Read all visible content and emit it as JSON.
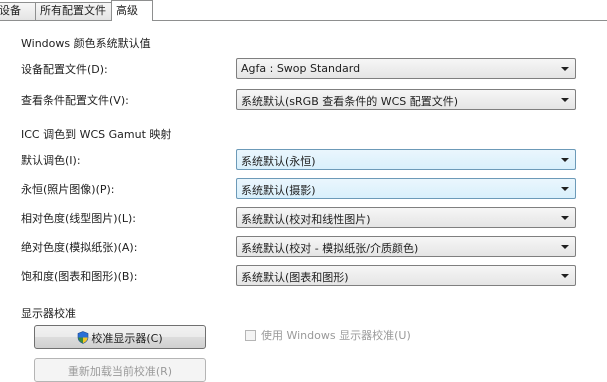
{
  "tabs": [
    "设备",
    "所有配置文件",
    "高级"
  ],
  "windows_defaults": {
    "heading": "Windows 颜色系统默认值",
    "device_profile": {
      "label": "设备配置文件(D):",
      "value": "Agfa : Swop Standard"
    },
    "viewing_conditions": {
      "label": "查看条件配置文件(V):",
      "value": "系统默认(sRGB 查看条件的 WCS 配置文件)"
    }
  },
  "gamut_mapping": {
    "heading": "ICC 调色到 WCS Gamut 映射",
    "rows": [
      {
        "label": "默认调色(I):",
        "value": "系统默认(永恒)"
      },
      {
        "label": "永恒(照片图像)(P):",
        "value": "系统默认(摄影)"
      },
      {
        "label": "相对色度(线型图片)(L):",
        "value": "系统默认(校对和线性图片)"
      },
      {
        "label": "绝对色度(模拟纸张)(A):",
        "value": "系统默认(校对 - 模拟纸张/介质颜色)"
      },
      {
        "label": "饱和度(图表和图形)(B):",
        "value": "系统默认(图表和图形)"
      }
    ]
  },
  "calibration": {
    "heading": "显示器校准",
    "calibrate_button": "校准显示器(C)",
    "use_calibration_label": "使用 Windows 显示器校准(U)",
    "use_calibration_checked": false,
    "reload_button": "重新加载当前校准(R)"
  },
  "icons": {
    "calibrate": "uac-shield-icon",
    "combo_arrow": "chevron-down-icon"
  }
}
